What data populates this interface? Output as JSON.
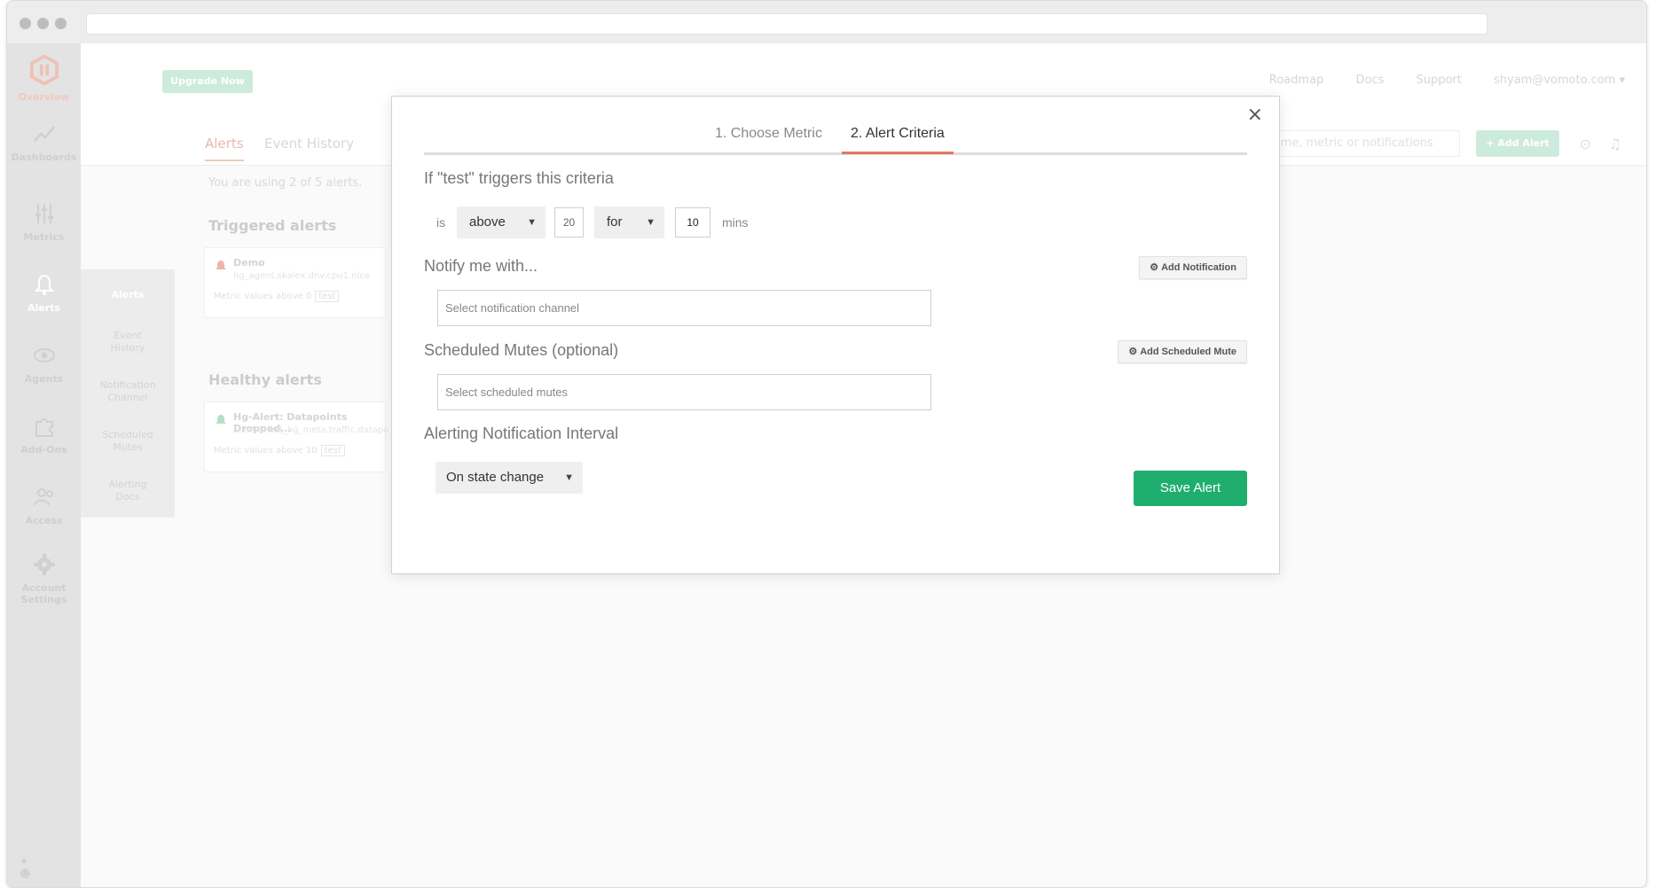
{
  "sidebar": {
    "items": [
      {
        "label": "Overview",
        "icon": "logo-icon"
      },
      {
        "label": "Dashboards",
        "icon": "chart-line-icon"
      },
      {
        "label": "Metrics",
        "icon": "sliders-icon"
      },
      {
        "label": "Alerts",
        "icon": "bell-icon"
      },
      {
        "label": "Agents",
        "icon": "eye-icon"
      },
      {
        "label": "Add-Ons",
        "icon": "puzzle-icon"
      },
      {
        "label": "Access",
        "icon": "users-icon"
      },
      {
        "label": "Account Settings",
        "icon": "gear-icon"
      }
    ]
  },
  "subnav": {
    "items": [
      "Alerts",
      "Event History",
      "Notification Channel",
      "Scheduled Mutes",
      "Alerting Docs"
    ]
  },
  "topbar": {
    "upgrade_label": "Upgrade Now",
    "links": [
      "Roadmap",
      "Docs",
      "Support",
      "shyam@vomoto.com ▾"
    ]
  },
  "page": {
    "tabs": [
      "Alerts",
      "Event History"
    ],
    "search_placeholder": "n name, metric or notifications",
    "add_alert_label": "+ Add Alert",
    "usage_text": "You are using 2 of 5 alerts.",
    "triggered_title": "Triggered alerts",
    "healthy_title": "Healthy alerts",
    "triggered_card": {
      "name": "Demo",
      "metric": "hg_agent.skalex.dnv.cpu1.nice",
      "value": "Metric values above 0",
      "tag": "test"
    },
    "healthy_card": {
      "name": "Hg-Alert: Datapoints Dropped...",
      "metric": "sumSeries(_hg_meta.traffic.datapo",
      "value": "Metric values above 10",
      "tag": "test"
    }
  },
  "modal": {
    "close_label": "×",
    "steps": [
      "1. Choose Metric",
      "2. Alert Criteria"
    ],
    "criteria_title": "If \"test\" triggers this criteria",
    "criteria": {
      "is_label": "is",
      "comparator": "above",
      "threshold": "20",
      "duration_mode": "for",
      "duration": "10",
      "unit": "mins"
    },
    "notify_title": "Notify me with...",
    "add_notification_label": "Add Notification",
    "notification_placeholder": "Select notification channel",
    "mutes_title": "Scheduled Mutes (optional)",
    "add_mute_label": "Add Scheduled Mute",
    "mutes_placeholder": "Select scheduled mutes",
    "interval_title": "Alerting Notification Interval",
    "interval_value": "On state change",
    "save_label": "Save Alert"
  },
  "colors": {
    "accent_tab": "#e8775d",
    "save_green": "#1fae6e"
  }
}
